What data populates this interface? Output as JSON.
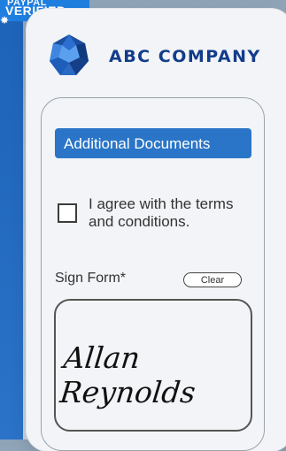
{
  "badge": {
    "top_text": "PAYPAL",
    "label": "VERIFIED"
  },
  "header": {
    "company": "ABC COMPANY"
  },
  "form": {
    "documents_button": "Additional Documents",
    "agree_text": "I agree with the terms and conditions.",
    "sign_label": "Sign Form*",
    "clear_button": "Clear",
    "signature": "Allan Reynolds"
  },
  "colors": {
    "accent": "#2a75c7",
    "brand": "#133c8a",
    "badge": "#1f7fe0"
  }
}
